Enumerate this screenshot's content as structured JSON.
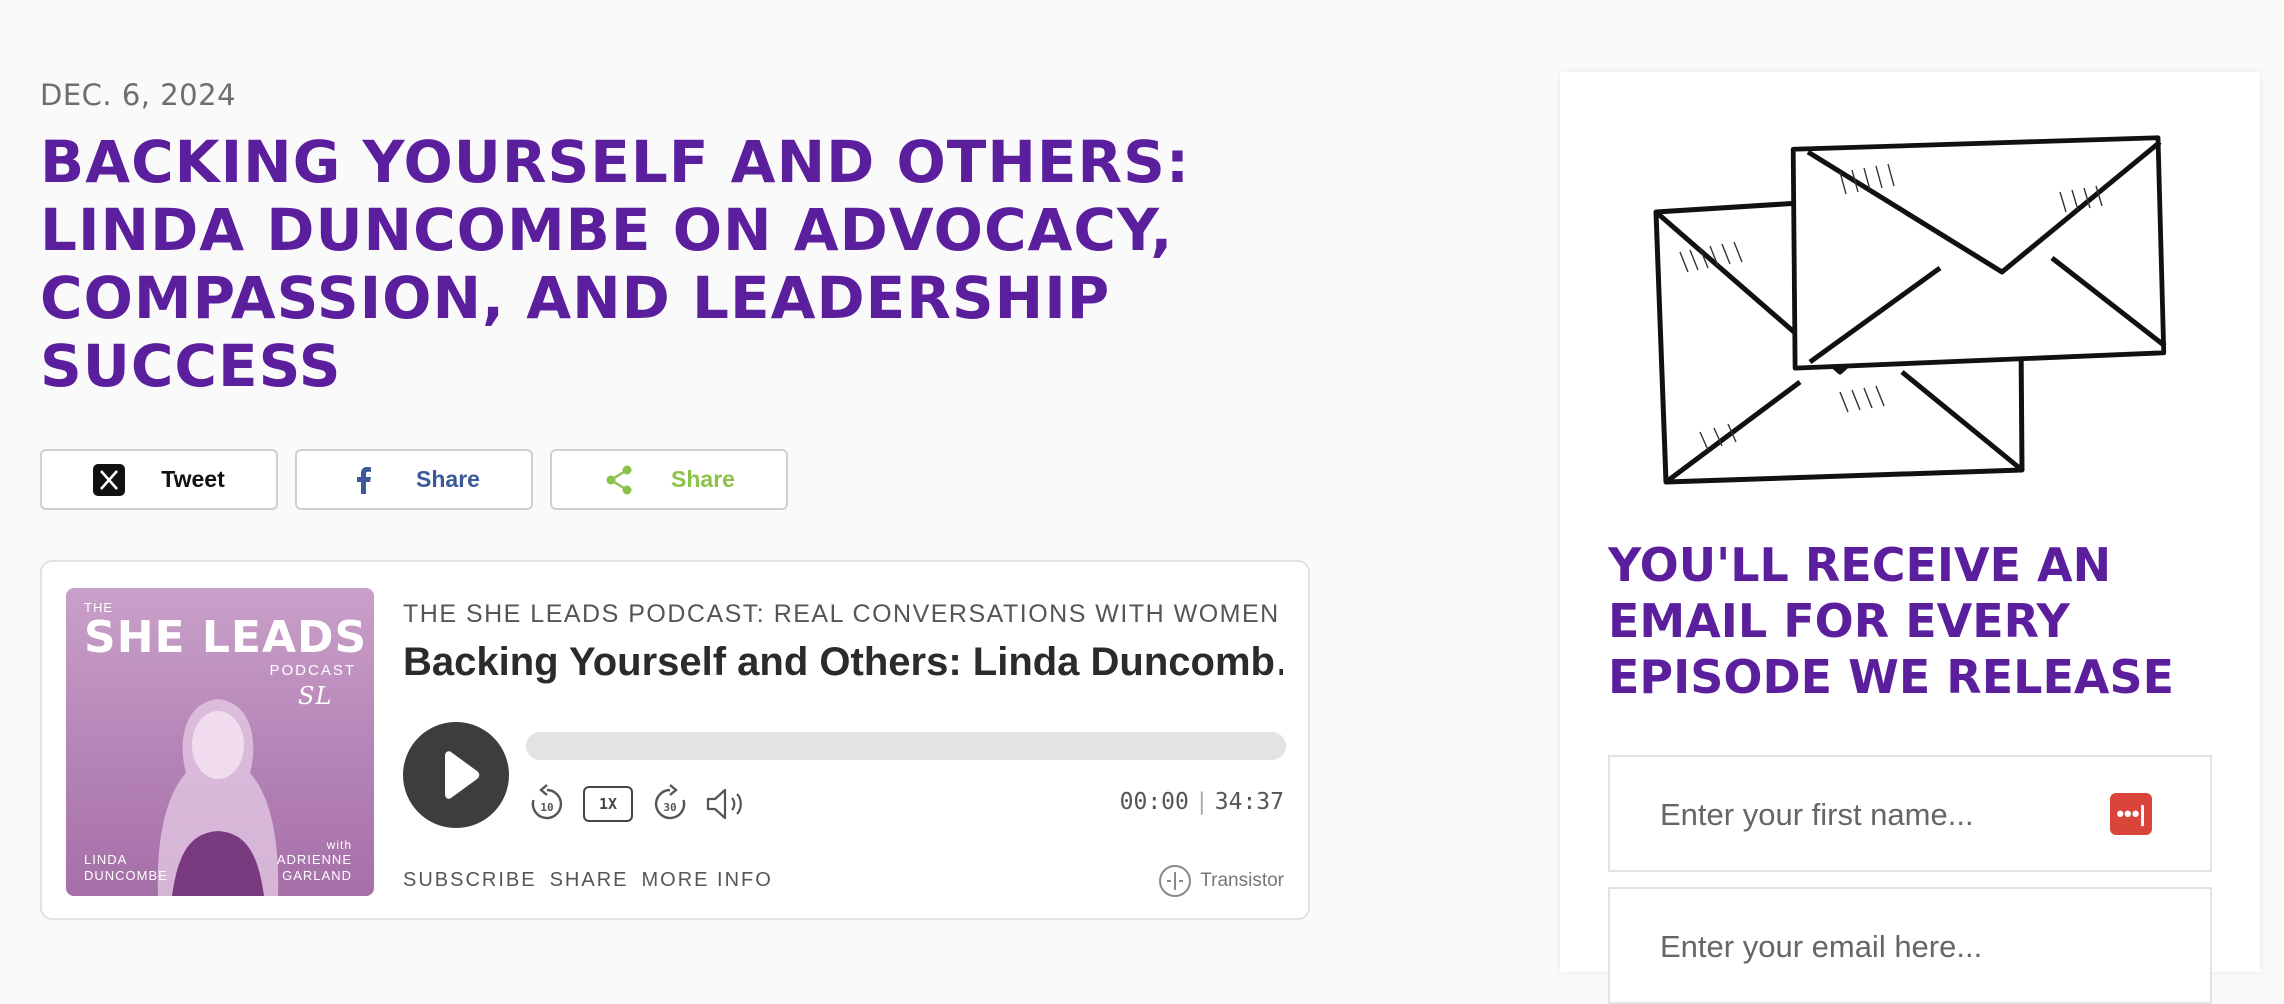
{
  "post": {
    "date": "DEC. 6, 2024",
    "title": "BACKING YOURSELF AND OTHERS: LINDA DUNCOMBE ON ADVOCACY, COMPASSION, AND LEADERSHIP SUCCESS"
  },
  "share": {
    "tweet_label": "Tweet",
    "facebook_label": "Share",
    "generic_label": "Share"
  },
  "player": {
    "cover": {
      "the": "THE",
      "brand": "SHE LEADS",
      "podcast": "PODCAST",
      "guest": "LINDA\nDUNCOMBE",
      "with": "with",
      "host": "ADRIENNE\nGARLAND"
    },
    "show": "THE SHE LEADS PODCAST: REAL CONVERSATIONS WITH WOMEN ENT…",
    "episode": "Backing Yourself and Others: Linda Duncomb…",
    "skip_back": "10",
    "speed": "1X",
    "skip_forward": "30",
    "current_time": "00:00",
    "duration": "34:37",
    "progress": 0,
    "links": {
      "subscribe": "SUBSCRIBE",
      "share": "SHARE",
      "more_info": "MORE INFO"
    },
    "powered_by": "Transistor"
  },
  "signup": {
    "heading": "YOU'LL RECEIVE AN EMAIL FOR EVERY EPISODE WE RELEASE",
    "first_name_placeholder": "Enter your first name...",
    "email_placeholder": "Enter your email here..."
  },
  "colors": {
    "accent": "#5b1f9e",
    "facebook": "#3b5998",
    "share_green": "#8bc34a",
    "player_dark": "#3d3d3d"
  },
  "icons": [
    "x-icon",
    "facebook-icon",
    "share-icon",
    "play-icon",
    "rewind-10-icon",
    "forward-30-icon",
    "volume-icon",
    "transistor-icon",
    "password-manager-icon",
    "envelopes-illustration"
  ]
}
